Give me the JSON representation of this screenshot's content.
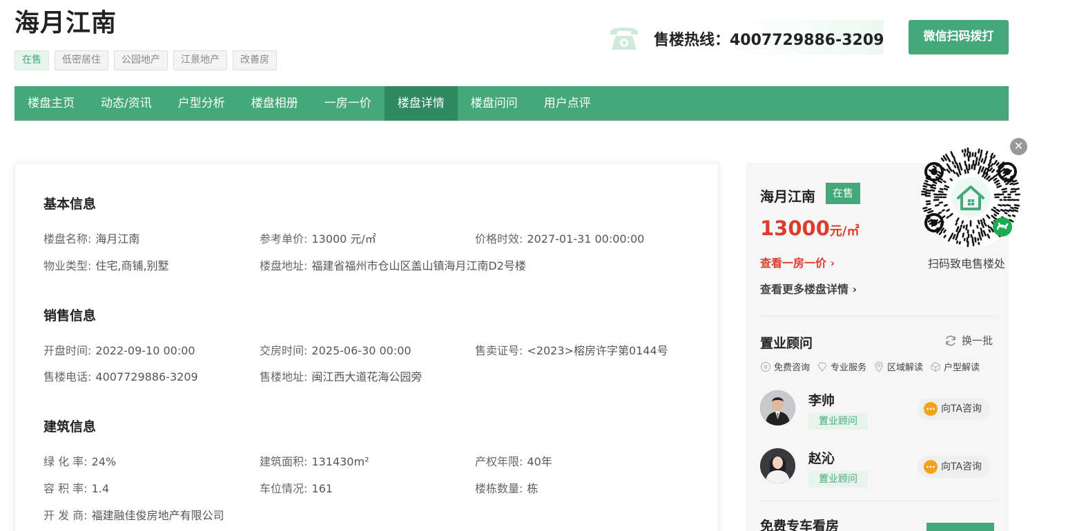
{
  "header": {
    "title": "海月江南",
    "tags": [
      "在售",
      "低密居住",
      "公园地产",
      "江景地产",
      "改善房"
    ],
    "hotline_label": "售楼热线：4007729886-3209",
    "scan_button": "微信扫码拨打"
  },
  "nav": {
    "items": [
      "楼盘主页",
      "动态/资讯",
      "户型分析",
      "楼盘相册",
      "一房一价",
      "楼盘详情",
      "楼盘问问",
      "用户点评"
    ],
    "active": "楼盘详情"
  },
  "main": {
    "basic_title": "基本信息",
    "basic": [
      {
        "k": "楼盘名称:",
        "v": "海月江南"
      },
      {
        "k": "参考单价:",
        "v": "13000 元/㎡"
      },
      {
        "k": "价格时效:",
        "v": "2027-01-31 00:00:00"
      },
      {
        "k": "物业类型:",
        "v": "住宅,商铺,别墅"
      },
      {
        "k": "楼盘地址:",
        "v": "福建省福州市仓山区盖山镇海月江南D2号楼"
      }
    ],
    "sales_title": "销售信息",
    "sales": [
      {
        "k": "开盘时间:",
        "v": "2022-09-10 00:00"
      },
      {
        "k": "交房时间:",
        "v": "2025-06-30 00:00"
      },
      {
        "k": "售卖证号:",
        "v": "<2023>榕房许字第0144号"
      },
      {
        "k": "售楼电话:",
        "v": "4007729886-3209"
      },
      {
        "k": "售楼地址:",
        "v": "闽江西大道花海公园旁"
      }
    ],
    "building_title": "建筑信息",
    "building": [
      {
        "k": "绿 化 率:",
        "v": "24%"
      },
      {
        "k": "建筑面积:",
        "v": "131430m²"
      },
      {
        "k": "产权年限:",
        "v": "40年"
      },
      {
        "k": "容 积 率:",
        "v": "1.4"
      },
      {
        "k": "车位情况:",
        "v": "161"
      },
      {
        "k": "楼栋数量:",
        "v": "栋"
      },
      {
        "k": "开 发 商:",
        "v": "福建融佳俊房地产有限公司"
      }
    ]
  },
  "sidebar": {
    "name": "海月江南",
    "badge": "在售",
    "price_num": "13000",
    "price_unit": "元/㎡",
    "link_price": "查看一房一价",
    "link_more": "查看更多楼盘详情",
    "advisor_title": "置业顾问",
    "refresh": "换一批",
    "features": [
      "免费咨询",
      "专业服务",
      "区域解读",
      "户型解读"
    ],
    "agents": [
      {
        "name": "李帅",
        "role": "置业顾问",
        "consult": "向TA咨询"
      },
      {
        "name": "赵沁",
        "role": "置业顾问",
        "consult": "向TA咨询"
      }
    ],
    "free_car": "免费专车看房"
  },
  "qr": {
    "caption": "扫码致电售楼处"
  },
  "colors": {
    "brand": "#45a87a",
    "brand_dark": "#2e8860",
    "price": "#e03a2c"
  }
}
